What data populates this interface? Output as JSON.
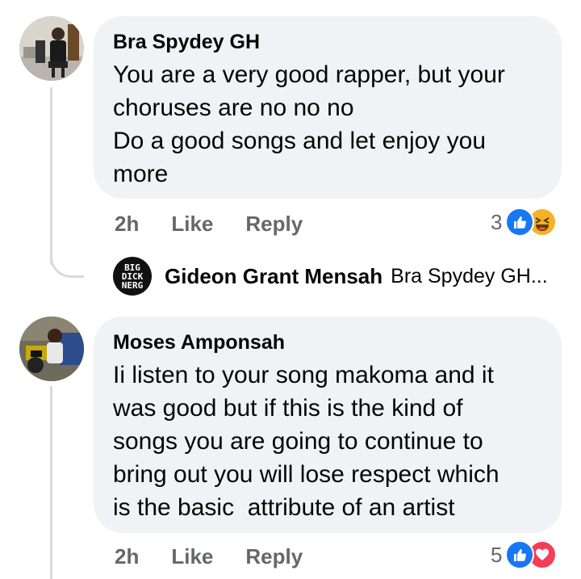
{
  "comments": [
    {
      "author": "Bra Spydey GH",
      "avatar_icon": "person-at-desk-avatar",
      "text_lines": [
        "You are a very good rapper, but your",
        "choruses are no no no",
        "Do a good songs and let enjoy you",
        "more"
      ],
      "time": "2h",
      "like_label": "Like",
      "reply_label": "Reply",
      "reaction_count": "3",
      "reactions": [
        "like-icon",
        "haha-icon"
      ],
      "reply_preview": {
        "logo_text": [
          "BIG",
          "DICK",
          "NERG"
        ],
        "author": "Gideon Grant Mensah",
        "snippet": "Bra Spydey GH..."
      }
    },
    {
      "author": "Moses Amponsah",
      "avatar_icon": "person-with-motorbike-avatar",
      "text_lines": [
        "Ii listen to your song makoma and it",
        "was good but if this is the kind of",
        "songs you are going to continue to",
        "bring out you will lose respect which",
        "is the basic  attribute of an artist"
      ],
      "time": "2h",
      "like_label": "Like",
      "reply_label": "Reply",
      "reaction_count": "5",
      "reactions": [
        "like-icon",
        "love-icon"
      ]
    }
  ],
  "colors": {
    "bubble": "#f0f2f5",
    "meta": "#65676b",
    "like_blue": "#1877f2",
    "love_red": "#f33e58",
    "haha_yellow": "#f7b125"
  }
}
